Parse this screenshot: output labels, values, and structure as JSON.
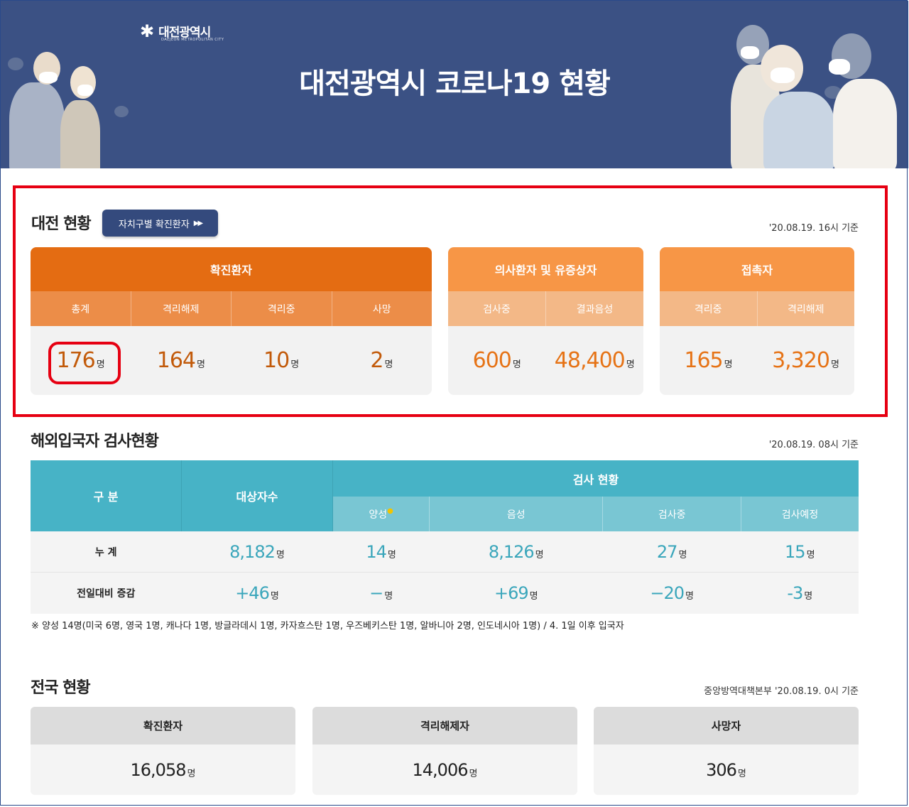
{
  "banner": {
    "logo_text": "대전광역시",
    "logo_en": "DAEJEON METROPOLITAN CITY",
    "title": "대전광역시 코로나19 현황"
  },
  "daejeon": {
    "title": "대전 현황",
    "region_button": "자치구별 확진환자",
    "basis": "'20.08.19. 16시 기준",
    "confirmed": {
      "header": "확진환자",
      "cols": [
        "총계",
        "격리해제",
        "격리중",
        "사망"
      ],
      "values": [
        "176",
        "164",
        "10",
        "2"
      ]
    },
    "suspected": {
      "header": "의사환자 및 유증상자",
      "cols": [
        "검사중",
        "결과음성"
      ],
      "values": [
        "600",
        "48,400"
      ]
    },
    "contacts": {
      "header": "접촉자",
      "cols": [
        "격리중",
        "격리해제"
      ],
      "values": [
        "165",
        "3,320"
      ]
    },
    "unit": "명",
    "colors": {
      "dark_orange": "#e46c12",
      "orange": "#f79646",
      "light_orange": "#f3b887",
      "highlight": "#e60012"
    }
  },
  "overseas": {
    "title": "해외입국자 검사현황",
    "basis": "'20.08.19. 08시 기준",
    "head_category": "구 분",
    "head_targets": "대상자수",
    "head_test": "검사 현황",
    "sub": [
      "양성",
      "음성",
      "검사중",
      "검사예정"
    ],
    "rows": [
      {
        "label": "누 계",
        "targets": "8,182",
        "values": [
          "14",
          "8,126",
          "27",
          "15"
        ]
      },
      {
        "label": "전일대비 증감",
        "targets": "+46",
        "values": [
          "−",
          "+69",
          "−20",
          "-3"
        ]
      }
    ],
    "unit": "명",
    "note": "※ 양성 14명(미국 6명, 영국 1명, 캐나다 1명, 방글라데시 1명, 카자흐스탄 1명, 우즈베키스탄 1명, 알바니아 2명, 인도네시아 1명) / 4. 1일 이후 입국자"
  },
  "national": {
    "title": "전국 현황",
    "basis": "중앙방역대책본부 '20.08.19. 0시 기준",
    "cards": [
      {
        "label": "확진환자",
        "value": "16,058"
      },
      {
        "label": "격리해제자",
        "value": "14,006"
      },
      {
        "label": "사망자",
        "value": "306"
      }
    ],
    "unit": "명"
  }
}
